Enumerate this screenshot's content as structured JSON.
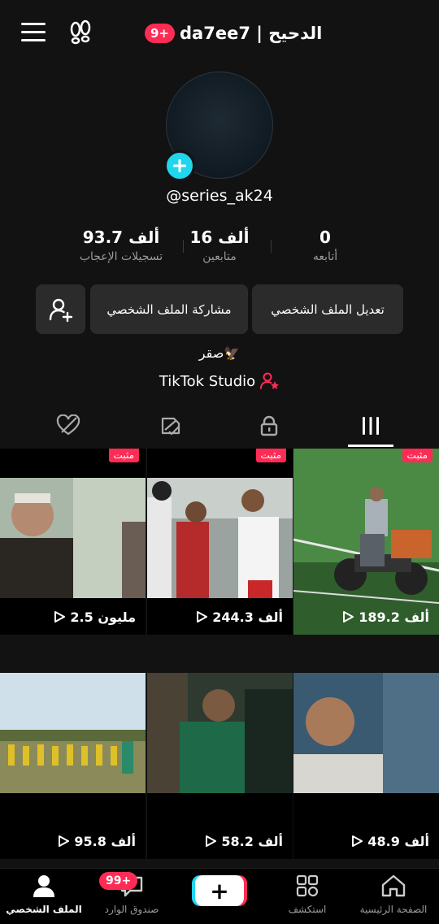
{
  "header": {
    "notification_count": "9+",
    "title": "da7ee7 | الدحيح"
  },
  "profile": {
    "username": "@series_ak24",
    "bio": "صقر🦅",
    "studio_link": "TikTok Studio"
  },
  "stats": {
    "likes": {
      "value": "93.7 ألف",
      "label": "تسجيلات الإعجاب"
    },
    "followers": {
      "value": "16 ألف",
      "label": "متابعين"
    },
    "following": {
      "value": "0",
      "label": "أتابعه"
    }
  },
  "buttons": {
    "edit_profile": "تعديل الملف الشخصي",
    "share_profile": "مشاركة الملف الشخصي"
  },
  "tabs": [
    "videos-grid",
    "private-lock",
    "reposts",
    "liked-hidden"
  ],
  "videos": [
    {
      "views": "189.2 ألف",
      "pinned": "مثبت"
    },
    {
      "views": "244.3 ألف",
      "pinned": "مثبت"
    },
    {
      "views": "2.5 مليون",
      "pinned": "مثبت"
    },
    {
      "views": "48.9 ألف",
      "pinned": ""
    },
    {
      "views": "58.2 ألف",
      "pinned": ""
    },
    {
      "views": "95.8 ألف",
      "pinned": ""
    }
  ],
  "bottom_nav": {
    "home": "الصفحة الرئيسية",
    "explore": "استكشف",
    "create": "+",
    "inbox": "صندوق الوارد",
    "inbox_badge": "99+",
    "profile": "الملف الشخصي"
  },
  "colors": {
    "accent": "#fe2c55",
    "cyan": "#20d5ec",
    "background": "#121212",
    "button": "#2b2b2b"
  }
}
